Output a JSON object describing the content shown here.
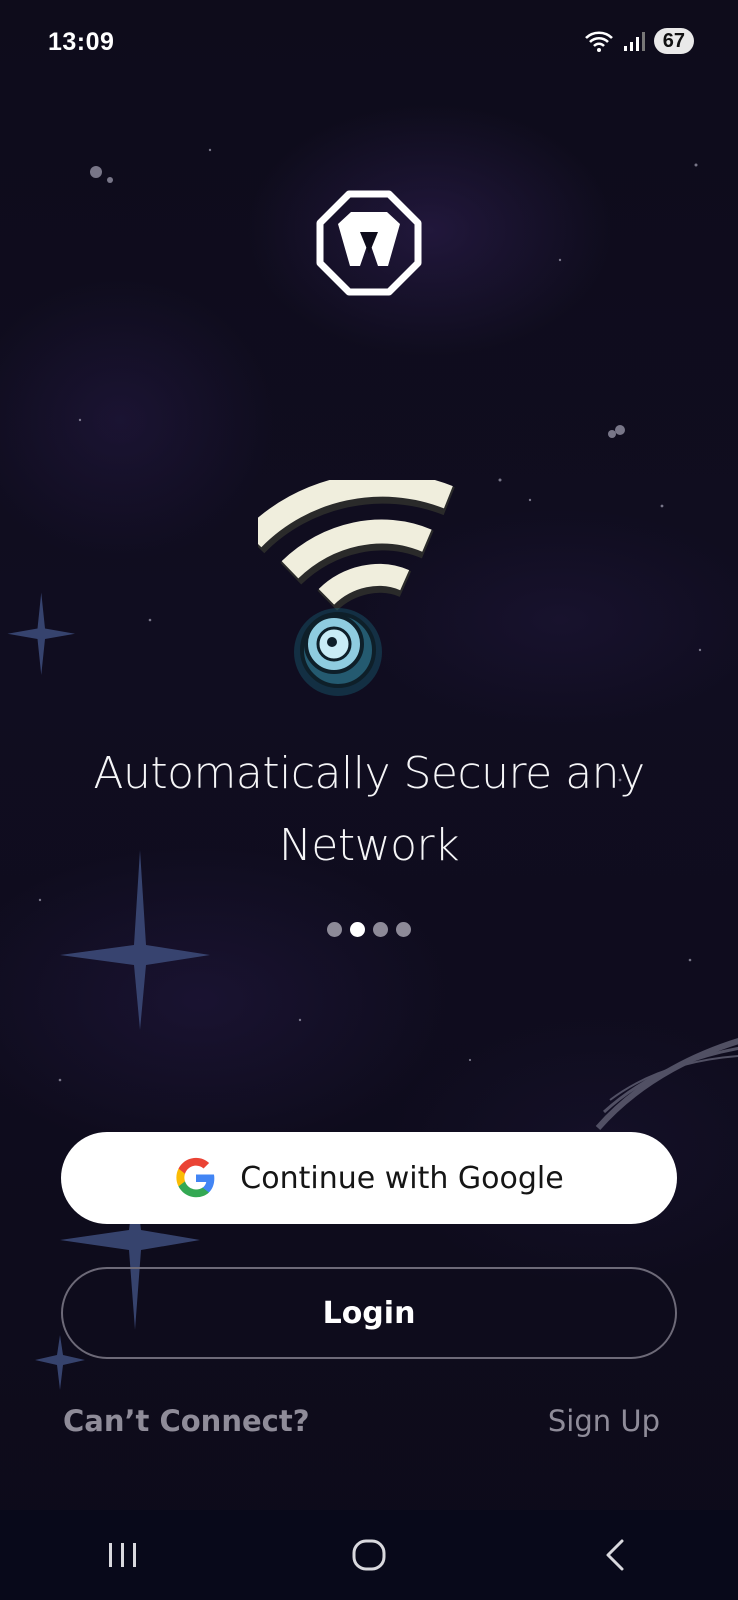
{
  "status_bar": {
    "time": "13:09",
    "battery": "67",
    "icons": [
      "wifi-icon",
      "signal-icon",
      "battery-icon"
    ]
  },
  "logo": {
    "name": "windscribe-logo"
  },
  "onboarding": {
    "headline": "Automatically Secure any Network",
    "pager": {
      "total": 4,
      "active_index": 1
    }
  },
  "actions": {
    "google_button_label": "Continue with Google",
    "login_button_label": "Login",
    "cant_connect_label": "Can’t Connect?",
    "sign_up_label": "Sign Up"
  },
  "nav_bar": {
    "icons": [
      "recent-apps-icon",
      "home-icon",
      "back-icon"
    ]
  },
  "colors": {
    "background": "#0d0b1a",
    "text_primary": "#ffffff",
    "text_muted": "#8f8c99",
    "button_primary_bg": "#ffffff",
    "button_outline": "#6d6a78",
    "nav_bar_bg": "#08091a"
  }
}
